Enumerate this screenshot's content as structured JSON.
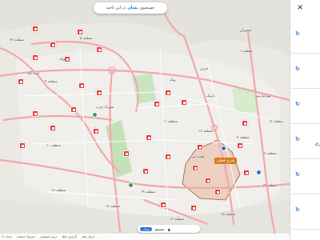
{
  "search": {
    "label": "جستجوی",
    "brand": "نشان",
    "suffix": "در این ناحیه"
  },
  "panel": {
    "close": "×",
    "rows": [
      {
        "icon": "↻",
        "text": ""
      },
      {
        "icon": "↻",
        "text": ""
      },
      {
        "icon": "↻",
        "text": ""
      },
      {
        "icon": "↻",
        "text": "ری"
      },
      {
        "icon": "↻",
        "text": ""
      },
      {
        "icon": "↻",
        "text": ""
      }
    ]
  },
  "highlight": {
    "label": "شرح فعلی"
  },
  "map_labels": {
    "l1": "منطقه ۲۲",
    "l2": "منطقه ۵",
    "l3": "منطقه ۲",
    "l4": "منطقه ۳",
    "l5": "منطقه ۱",
    "l6": "ونک",
    "l7": "جردن",
    "l8": "پونک",
    "l9": "شهرک غرب",
    "l10": "منطقه ۹",
    "l11": "منطقه ۱۰",
    "l12": "منطقه ۱۱",
    "l13": "منطقه ۱۲",
    "l14": "منطقه ۱۴",
    "l15": "منطقه ۱۳",
    "l16": "منطقه ۱۵",
    "l17": "منطقه ۱۶",
    "l18": "منطقه ۱۷",
    "l19": "منطقه ۱۸",
    "l20": "منطقه ۱۹",
    "l21": "نارمک",
    "l22": "تهرانپارس",
    "l23": "شمیران",
    "l24": "جنت آباد",
    "l25": "هفت تیر"
  },
  "bottombar": {
    "items": [
      "© نشان",
      "شرایط استفاده",
      "حریم خصوصی",
      "گزارش خطا",
      "ارسال نظر"
    ]
  },
  "controls": {
    "pill": "نشان",
    "text": "جستجو",
    "icon": "▲"
  }
}
